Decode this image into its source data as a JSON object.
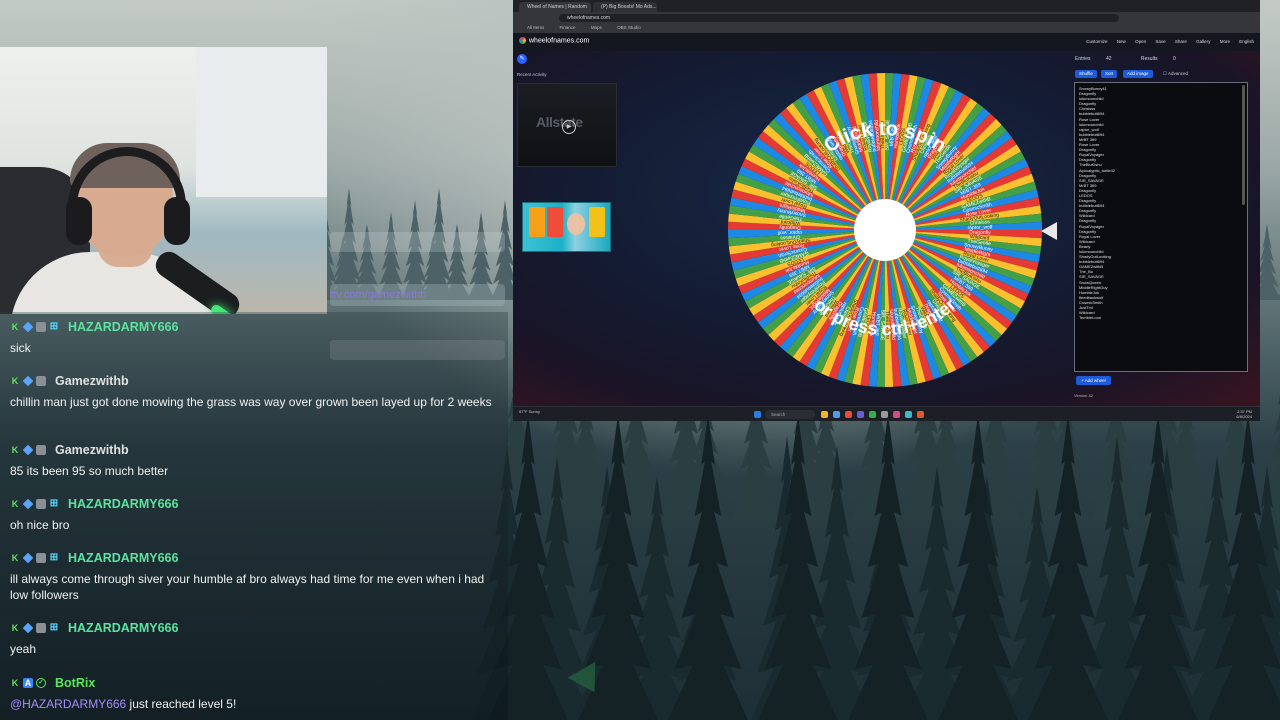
{
  "overlay": {
    "handle": "ttv.com/gamezwithb"
  },
  "chat": {
    "messages": [
      {
        "user": "HAZARDARMY666",
        "text": "sick",
        "color": "#5ce3a0"
      },
      {
        "user": "Gamezwithb",
        "text": "chillin man just got done mowing the grass was way over grown been layed up for 2 weeks",
        "color": "#e0e0e0"
      },
      {
        "user": "Gamezwithb",
        "text": "85 its been 95 so much better",
        "color": "#e0e0e0"
      },
      {
        "user": "HAZARDARMY666",
        "text": "oh nice bro",
        "color": "#5ce3a0"
      },
      {
        "user": "HAZARDARMY666",
        "text": "ill always come through siver your humble af bro always had time for me even when i had low followers",
        "color": "#5ce3a0"
      },
      {
        "user": "HAZARDARMY666",
        "text": "yeah",
        "color": "#5ce3a0"
      },
      {
        "user": "BotRix",
        "mention": "@HAZARDARMY666",
        "text": " just reached level 5!",
        "color": "#5ce35c"
      }
    ]
  },
  "browser": {
    "tabs": [
      "Wheel of Names | Random name...",
      "(P) Big Boosts! Mo Ads..."
    ],
    "url": "wheelofnames.com",
    "bookmarks": [
      "All Items",
      "Finance",
      "Maps",
      "OBS Studio"
    ]
  },
  "app": {
    "logo": "wheelofnames.com",
    "menu": [
      "Customize",
      "New",
      "Open",
      "Save",
      "Share",
      "Gallery",
      "More",
      "English"
    ],
    "recent_label": "Recent Activity",
    "ad_word": "Allstate",
    "wheel": {
      "top_text": "Click to spin",
      "bottom_text": "or press ctrl+enter",
      "colors": [
        "#e53935",
        "#fbc02d",
        "#43a047",
        "#1e88e5"
      ]
    },
    "entries_tab": "Entries",
    "entries_count": "42",
    "results_tab": "Results",
    "results_count": "0",
    "buttons": {
      "shuffle": "Shuffle",
      "sort": "Sort",
      "add_image": "Add image",
      "advanced": "Advanced",
      "add_wheel": "+ Add wheel"
    },
    "version": "Version 42",
    "entries": [
      "SnowyBunny41",
      "Dragonfly",
      "lulumoonchild",
      "Dragonfly",
      "Chrisisss",
      "bubblebutt694",
      "Rose Lover",
      "lulumoonchild",
      "raptor_wolf",
      "bubblebutt694",
      "MrBT 369",
      "Rose Lover",
      "Dragonfly",
      "RoyalVoyager",
      "Dragonfly",
      "TheBluKishu",
      "Apocalyptic_turtle42",
      "Dragonfly",
      "SIR_SAVAGE",
      "MrBT 369",
      "Dragonfly",
      "LEDOS",
      "Dragonfly",
      "bubblebutt694",
      "Dragonfly",
      "Wildcard",
      "Dragonfly",
      "RoyalVoyager",
      "Dragonfly",
      "Royal Lover",
      "Wildcard",
      "Bearly",
      "lulumoonchild",
      "ShadyOutLooking",
      "bubblebutt694",
      "GAMEZwithB",
      "The_Bo",
      "SIR_SAVAGE",
      "SnowQueen",
      "MiddleRightGuy",
      "HumbleJok",
      "fleedbackwolf",
      "CosmicSmith",
      "JustTrvl",
      "Wildcard",
      "TerribleLoon"
    ],
    "wheel_labels": [
      "Dragonfly",
      "Wildcard",
      "TheGentle",
      "SnowyBunny",
      "MiddleRight",
      "Royal Lover",
      "RoyalVoyager",
      "bubblebutt694",
      "lulumoonchild",
      "TheBluKishu",
      "SIR_SAVAGE",
      "MrBT 369",
      "HumbleJok",
      "LEDOS",
      "GAMEZwithB",
      "CosmicSmith",
      "Rose Lover",
      "ShadyOutLooking",
      "Chrisisss",
      "raptor_wolf"
    ]
  },
  "taskbar": {
    "search": "Search",
    "weather": "87°F Sunny",
    "time": "2:37 PM",
    "date": "6/8/2024"
  }
}
